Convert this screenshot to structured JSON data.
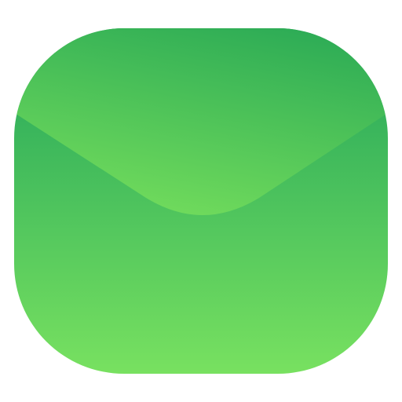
{
  "icon": {
    "name": "mail-envelope-icon",
    "colors": {
      "body_top": "#21a45a",
      "body_bottom": "#78e160",
      "flap_top": "#29a955",
      "flap_bottom": "#72dc5c",
      "background": "#ffffff"
    }
  }
}
